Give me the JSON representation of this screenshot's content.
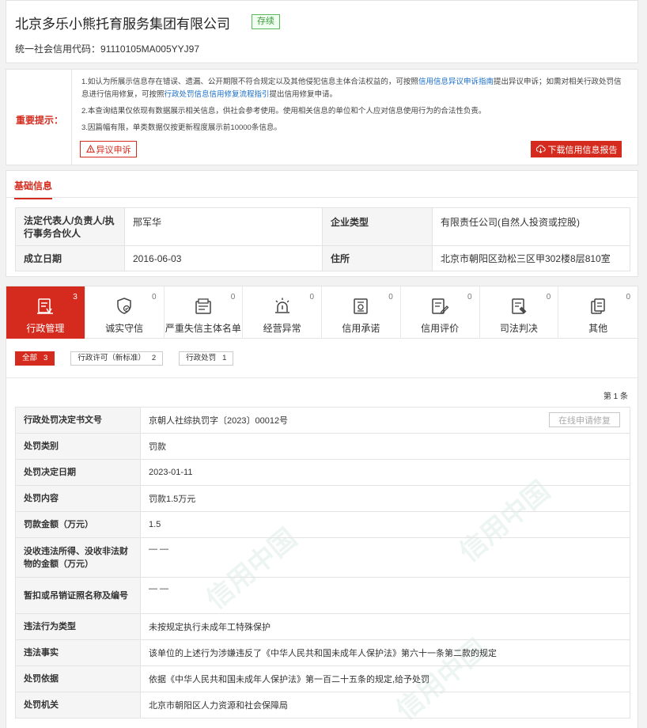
{
  "header": {
    "company_name": "北京多乐小熊托育服务集团有限公司",
    "status": "存续",
    "credit_code_label": "统一社会信用代码：",
    "credit_code": "91110105MA005YYJ97"
  },
  "notice": {
    "label": "重要提示：",
    "line1_a": "1.如认为所展示信息存在错误、遗漏、公开期限不符合规定以及其他侵犯信息主体合法权益的，可按照",
    "line1_link1": "信用信息异议申诉指南",
    "line1_b": "提出异议申诉；如需对相关行政处罚信息进行信用修复，可按照",
    "line1_link2": "行政处罚信息信用修复流程指引",
    "line1_c": "提出信用修复申请。",
    "line2": "2.本查询结果仅依现有数据展示相关信息，供社会参考使用。使用相关信息的单位和个人应对信息使用行为的合法性负责。",
    "line3": "3.因篇幅有限，单类数据仅按更新程度展示前10000条信息。",
    "objection_button": "异议申诉",
    "download_button": "下载信用信息报告"
  },
  "basic": {
    "tab_label": "基础信息",
    "legal_rep_label": "法定代表人/负责人/执行事务合伙人",
    "legal_rep_value": "邢军华",
    "company_type_label": "企业类型",
    "company_type_value": "有限责任公司(自然人投资或控股)",
    "founded_label": "成立日期",
    "founded_value": "2016-06-03",
    "address_label": "住所",
    "address_value": "北京市朝阳区劲松三区甲302楼8层810室"
  },
  "categories": [
    {
      "name": "行政管理",
      "count": "3",
      "icon": "admin-doc-icon"
    },
    {
      "name": "诚实守信",
      "count": "0",
      "icon": "honesty-shield-icon"
    },
    {
      "name": "严重失信主体名单",
      "count": "0",
      "icon": "blacklist-icon"
    },
    {
      "name": "经营异常",
      "count": "0",
      "icon": "alarm-light-icon"
    },
    {
      "name": "信用承诺",
      "count": "0",
      "icon": "promise-doc-icon"
    },
    {
      "name": "信用评价",
      "count": "0",
      "icon": "evaluation-icon"
    },
    {
      "name": "司法判决",
      "count": "0",
      "icon": "judgment-icon"
    },
    {
      "name": "其他",
      "count": "0",
      "icon": "other-doc-icon"
    }
  ],
  "subtabs": [
    {
      "label": "全部",
      "count": "3"
    },
    {
      "label": "行政许可（新标准）",
      "count": "2"
    },
    {
      "label": "行政处罚",
      "count": "1"
    }
  ],
  "page_count": "第 1 条",
  "penalty": {
    "repair_button": "在线申请修复",
    "rows": [
      {
        "label": "行政处罚决定书文号",
        "value": "京朝人社综执罚字〔2023〕00012号"
      },
      {
        "label": "处罚类别",
        "value": "罚款"
      },
      {
        "label": "处罚决定日期",
        "value": "2023-01-11"
      },
      {
        "label": "处罚内容",
        "value": "罚款1.5万元"
      },
      {
        "label": "罚款金额（万元）",
        "value": "1.5"
      },
      {
        "label": "没收违法所得、没收非法财物的金额（万元）",
        "value": "— —"
      },
      {
        "label": "暂扣或吊销证照名称及编号",
        "value": "— —"
      },
      {
        "label": "违法行为类型",
        "value": "未按规定执行未成年工特殊保护"
      },
      {
        "label": "违法事实",
        "value": "该单位的上述行为涉嫌违反了《中华人民共和国未成年人保护法》第六十一条第二款的规定"
      },
      {
        "label": "处罚依据",
        "value": "依据《中华人民共和国未成年人保护法》第一百二十五条的规定,给予处罚"
      },
      {
        "label": "处罚机关",
        "value": "北京市朝阳区人力资源和社会保障局"
      }
    ]
  }
}
